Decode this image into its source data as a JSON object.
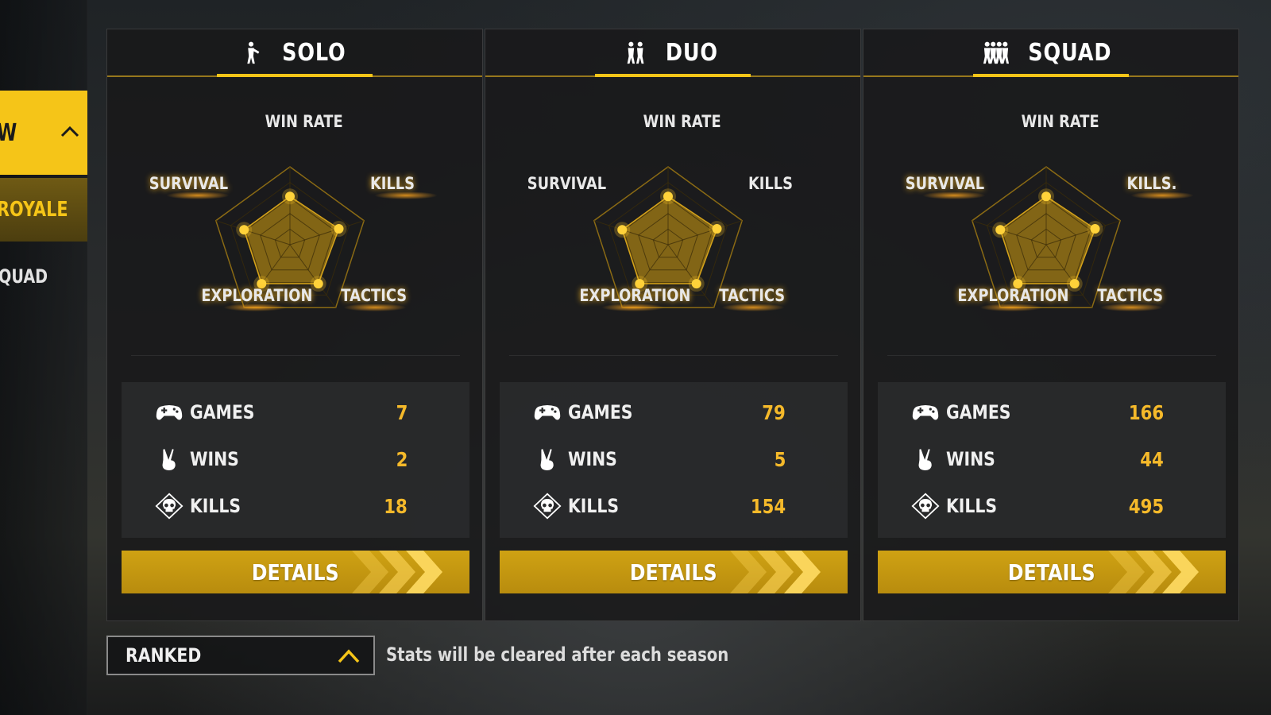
{
  "sidebar": {
    "active_item": "W",
    "royale_item": "ROYALE",
    "squad_item": "QUAD"
  },
  "colors": {
    "accent": "#f5c518",
    "value": "#f5b92a",
    "button": "#c39a10"
  },
  "panels": [
    {
      "mode": "SOLO",
      "icon": "solo-player-icon",
      "radar": {
        "labels": [
          "WIN RATE",
          "KILLS",
          "TACTICS",
          "EXPLORATION",
          "SURVIVAL"
        ],
        "highlighted": [
          "KILLS",
          "TACTICS",
          "EXPLORATION",
          "SURVIVAL"
        ],
        "values": [
          0.62,
          0.66,
          0.62,
          0.62,
          0.62
        ]
      },
      "stats": [
        {
          "label": "GAMES",
          "value": "7",
          "icon": "gamepad-icon"
        },
        {
          "label": "WINS",
          "value": "2",
          "icon": "victory-hand-icon"
        },
        {
          "label": "KILLS",
          "value": "18",
          "icon": "skull-icon"
        }
      ],
      "details_label": "DETAILS"
    },
    {
      "mode": "DUO",
      "icon": "duo-players-icon",
      "radar": {
        "labels": [
          "WIN RATE",
          "KILLS",
          "TACTICS",
          "EXPLORATION",
          "SURVIVAL"
        ],
        "highlighted": [
          "TACTICS",
          "EXPLORATION"
        ],
        "values": [
          0.62,
          0.66,
          0.62,
          0.62,
          0.62
        ]
      },
      "stats": [
        {
          "label": "GAMES",
          "value": "79",
          "icon": "gamepad-icon"
        },
        {
          "label": "WINS",
          "value": "5",
          "icon": "victory-hand-icon"
        },
        {
          "label": "KILLS",
          "value": "154",
          "icon": "skull-icon"
        }
      ],
      "details_label": "DETAILS"
    },
    {
      "mode": "SQUAD",
      "icon": "squad-players-icon",
      "radar": {
        "labels": [
          "WIN RATE",
          "KILLS.",
          "TACTICS",
          "EXPLORATION",
          "SURVIVAL"
        ],
        "highlighted": [
          "KILLS.",
          "TACTICS",
          "EXPLORATION",
          "SURVIVAL"
        ],
        "values": [
          0.62,
          0.66,
          0.62,
          0.62,
          0.62
        ]
      },
      "stats": [
        {
          "label": "GAMES",
          "value": "166",
          "icon": "gamepad-icon"
        },
        {
          "label": "WINS",
          "value": "44",
          "icon": "victory-hand-icon"
        },
        {
          "label": "KILLS",
          "value": "495",
          "icon": "skull-icon"
        }
      ],
      "details_label": "DETAILS"
    }
  ],
  "footer": {
    "season_type": "RANKED",
    "note": "Stats will be cleared after each season"
  }
}
